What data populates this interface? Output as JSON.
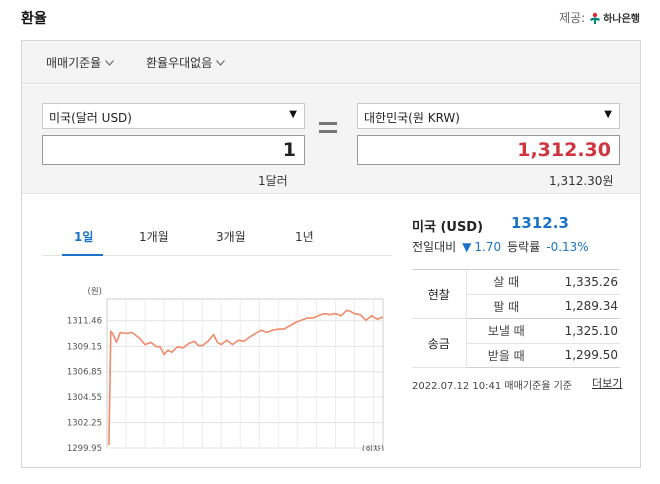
{
  "header": {
    "title": "환율",
    "provider_label": "제공:",
    "provider_name": "하나은행"
  },
  "filters": [
    {
      "label": "매매기준율",
      "icon": "chevron-down-icon"
    },
    {
      "label": "환율우대없음",
      "icon": "chevron-down-icon"
    }
  ],
  "converter": {
    "from_currency": "미국(달러 USD)",
    "from_amount": "1",
    "from_unit": "1달러",
    "to_currency": "대한민국(원 KRW)",
    "to_amount": "1,312.30",
    "to_unit": "1,312.30원",
    "to_amount_color": "#d0343e"
  },
  "tabs": [
    {
      "label": "1일",
      "active": true
    },
    {
      "label": "1개월",
      "active": false
    },
    {
      "label": "3개월",
      "active": false
    },
    {
      "label": "1년",
      "active": false
    }
  ],
  "quote": {
    "name": "미국 (USD)",
    "price": "1312.3",
    "change_label": "전일대비",
    "change_value": "1.70",
    "rate_label": "등락률",
    "rate_value": "-0.13%",
    "direction": "down"
  },
  "rates": {
    "cash_label": "현찰",
    "buy_label": "살 때",
    "buy_value": "1,335.26",
    "sell_label": "팔 때",
    "sell_value": "1,289.34",
    "remit_label": "송금",
    "send_label": "보낼 때",
    "send_value": "1,325.10",
    "receive_label": "받을 때",
    "receive_value": "1,299.50"
  },
  "footer": {
    "timestamp": "2022.07.12 10:41 매매기준율 기준",
    "more_label": "더보기"
  },
  "chart_data": {
    "type": "line",
    "ylabel": "(원)",
    "xlabel": "(회차)",
    "ylim": [
      1299.95,
      1312.7
    ],
    "xlim": [
      0,
      145
    ],
    "yticks": [
      "1311.46",
      "1309.15",
      "1306.85",
      "1304.55",
      "1302.25",
      "1299.95"
    ],
    "ytick_values": [
      1311.46,
      1309.15,
      1306.85,
      1304.55,
      1302.25,
      1299.95
    ],
    "xticks": [
      10,
      20,
      30,
      40,
      50,
      60,
      70,
      80,
      90,
      100,
      110,
      120,
      130,
      140
    ],
    "grid": true,
    "line_color": "#f08a6a",
    "x": [
      1,
      2,
      3,
      5,
      7,
      10,
      13,
      17,
      20,
      23,
      26,
      28,
      30,
      32,
      34,
      37,
      40,
      43,
      46,
      48,
      50,
      53,
      56,
      58,
      60,
      63,
      66,
      69,
      72,
      75,
      78,
      81,
      84,
      87,
      90,
      93,
      96,
      99,
      102,
      105,
      108,
      111,
      114,
      117,
      120,
      123,
      126,
      128,
      130,
      133,
      136,
      139,
      142,
      145
    ],
    "values": [
      1300.2,
      1310.5,
      1310.3,
      1309.5,
      1310.4,
      1310.3,
      1310.4,
      1309.9,
      1309.3,
      1309.5,
      1309.1,
      1309.1,
      1308.4,
      1308.8,
      1308.6,
      1309.1,
      1309.0,
      1309.4,
      1309.6,
      1309.2,
      1309.2,
      1309.6,
      1310.2,
      1309.5,
      1309.3,
      1309.7,
      1309.3,
      1309.7,
      1309.6,
      1310.0,
      1310.3,
      1310.6,
      1310.4,
      1310.6,
      1310.7,
      1310.7,
      1311.0,
      1311.3,
      1311.5,
      1311.7,
      1311.7,
      1311.9,
      1312.1,
      1312.0,
      1312.1,
      1311.9,
      1312.4,
      1312.3,
      1312.1,
      1312.0,
      1311.5,
      1311.9,
      1311.6,
      1311.8
    ]
  }
}
